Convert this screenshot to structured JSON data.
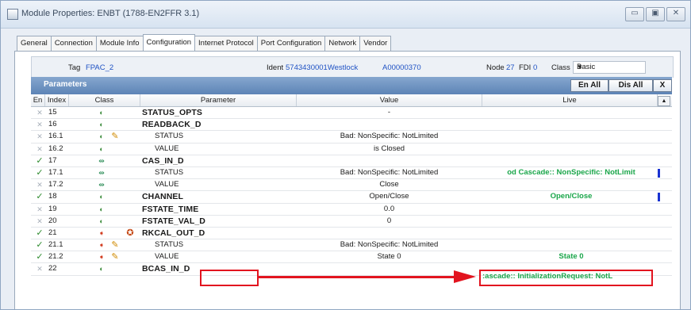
{
  "window": {
    "title": "Module Properties: ENBT (1788-EN2FFR 3.1)",
    "buttons": [
      "▭",
      "▣",
      "✕"
    ]
  },
  "tabs": [
    "General",
    "Connection",
    "Module Info",
    "Configuration",
    "Internet Protocol",
    "Port Configuration",
    "Network",
    "Vendor"
  ],
  "active_tab": "Configuration",
  "info": {
    "tag_label": "Tag",
    "tag_value": "FPAC_2",
    "ident_label": "Ident",
    "ident_value": "5743430001Westlock",
    "ident_code": "A00000370",
    "node_label": "Node",
    "node_value": "27",
    "fdi_label": "FDI",
    "fdi_value": "0",
    "class_label": "Class",
    "class_value": "Basic"
  },
  "parameters": {
    "title": "Parameters",
    "en_all": "En All",
    "dis_all": "Dis All",
    "close": "X"
  },
  "columns": [
    "En",
    "Index",
    "Class",
    "Parameter",
    "Value",
    "Live"
  ],
  "rows": [
    {
      "en": "x",
      "index": "15",
      "cls": "g",
      "edit": "",
      "flag": "",
      "param": "STATUS_OPTS",
      "bold": true,
      "value": "-",
      "live": ""
    },
    {
      "en": "x",
      "index": "16",
      "cls": "g",
      "edit": "",
      "flag": "",
      "param": "READBACK_D",
      "bold": true,
      "value": "",
      "live": ""
    },
    {
      "en": "x",
      "index": "16.1",
      "cls": "g",
      "edit": "✎",
      "flag": "",
      "param": "STATUS",
      "bold": false,
      "value": "Bad: NonSpecific: NotLimited",
      "live": ""
    },
    {
      "en": "x",
      "index": "16.2",
      "cls": "g",
      "edit": "",
      "flag": "",
      "param": "VALUE",
      "bold": false,
      "value": "is Closed",
      "live": ""
    },
    {
      "en": "v",
      "index": "17",
      "cls": "t",
      "edit": "",
      "flag": "",
      "param": "CAS_IN_D",
      "bold": true,
      "value": "",
      "live": ""
    },
    {
      "en": "v",
      "index": "17.1",
      "cls": "t",
      "edit": "",
      "flag": "",
      "param": "STATUS",
      "bold": false,
      "value": "Bad: NonSpecific: NotLimited",
      "live": "od Cascade:: NonSpecific: NotLimit",
      "marker": true
    },
    {
      "en": "x",
      "index": "17.2",
      "cls": "t",
      "edit": "",
      "flag": "",
      "param": "VALUE",
      "bold": false,
      "value": "Close",
      "live": ""
    },
    {
      "en": "v",
      "index": "18",
      "cls": "g",
      "edit": "",
      "flag": "",
      "param": "CHANNEL",
      "bold": true,
      "value": "Open/Close",
      "live": "Open/Close",
      "marker": true
    },
    {
      "en": "x",
      "index": "19",
      "cls": "g",
      "edit": "",
      "flag": "",
      "param": "FSTATE_TIME",
      "bold": true,
      "value": "0.0",
      "live": ""
    },
    {
      "en": "x",
      "index": "20",
      "cls": "g",
      "edit": "",
      "flag": "",
      "param": "FSTATE_VAL_D",
      "bold": true,
      "value": "0",
      "live": ""
    },
    {
      "en": "v",
      "index": "21",
      "cls": "o",
      "edit": "",
      "flag": "✪",
      "param": "RKCAL_OUT_D",
      "bold": true,
      "value": "",
      "live": ""
    },
    {
      "en": "v",
      "index": "21.1",
      "cls": "o",
      "edit": "✎",
      "flag": "",
      "param": "STATUS",
      "bold": false,
      "value": "Bad: NonSpecific: NotLimited",
      "live": "",
      "highlight": true
    },
    {
      "en": "v",
      "index": "21.2",
      "cls": "o",
      "edit": "✎",
      "flag": "",
      "param": "VALUE",
      "bold": false,
      "value": "State 0",
      "live": "State 0"
    },
    {
      "en": "x",
      "index": "22",
      "cls": "g",
      "edit": "",
      "flag": "",
      "param": "BCAS_IN_D",
      "bold": true,
      "value": "",
      "live": ""
    }
  ],
  "annotation": {
    "live_text": ":ascade:: InitializationRequest: NotL"
  },
  "colors": {
    "accent": "#5d84b6",
    "live_green": "#1aa64a",
    "annotation_red": "#e2141f",
    "marker_blue": "#1a33d1"
  }
}
